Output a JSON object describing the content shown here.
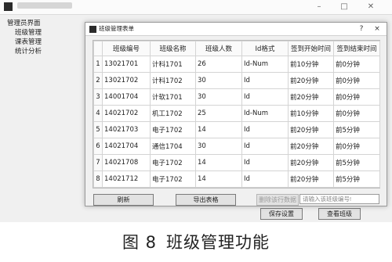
{
  "main_window": {
    "menu": {
      "root": "管理员界面",
      "items": [
        "班级管理",
        "课表管理",
        "统计分析"
      ]
    },
    "bottom_buttons": [
      "保存设置",
      "查看班级"
    ]
  },
  "dialog": {
    "title": "班级管理表单",
    "help_glyph": "?",
    "close_glyph": "×",
    "columns": [
      "班级编号",
      "班级名称",
      "班级人数",
      "Id格式",
      "签到开始时间",
      "签到结束时间"
    ],
    "rows": [
      {
        "num": "1",
        "cells": [
          "13021701",
          "计科1701",
          "26",
          "Id-Num",
          "前10分钟",
          "前0分钟"
        ]
      },
      {
        "num": "2",
        "cells": [
          "13021702",
          "计科1702",
          "30",
          "Id",
          "前20分钟",
          "前0分钟"
        ]
      },
      {
        "num": "3",
        "cells": [
          "14001704",
          "计软1701",
          "30",
          "Id",
          "前20分钟",
          "前0分钟"
        ]
      },
      {
        "num": "4",
        "cells": [
          "14021702",
          "机工1702",
          "25",
          "Id-Num",
          "前10分钟",
          "前0分钟"
        ]
      },
      {
        "num": "5",
        "cells": [
          "14021703",
          "电子1702",
          "14",
          "Id",
          "前20分钟",
          "前5分钟"
        ]
      },
      {
        "num": "6",
        "cells": [
          "14021704",
          "通信1704",
          "30",
          "Id",
          "前20分钟",
          "前0分钟"
        ]
      },
      {
        "num": "7",
        "cells": [
          "14021708",
          "电子1702",
          "14",
          "Id",
          "前20分钟",
          "前5分钟"
        ]
      },
      {
        "num": "8",
        "cells": [
          "14021712",
          "电子1702",
          "14",
          "Id",
          "前20分钟",
          "前5分钟"
        ]
      }
    ],
    "refresh_label": "刷新",
    "export_label": "导出表格",
    "delete_label": "删除该行数据",
    "search_placeholder": "请输入该班级编号!"
  },
  "figure": {
    "number": "图 8",
    "caption": "班级管理功能"
  }
}
